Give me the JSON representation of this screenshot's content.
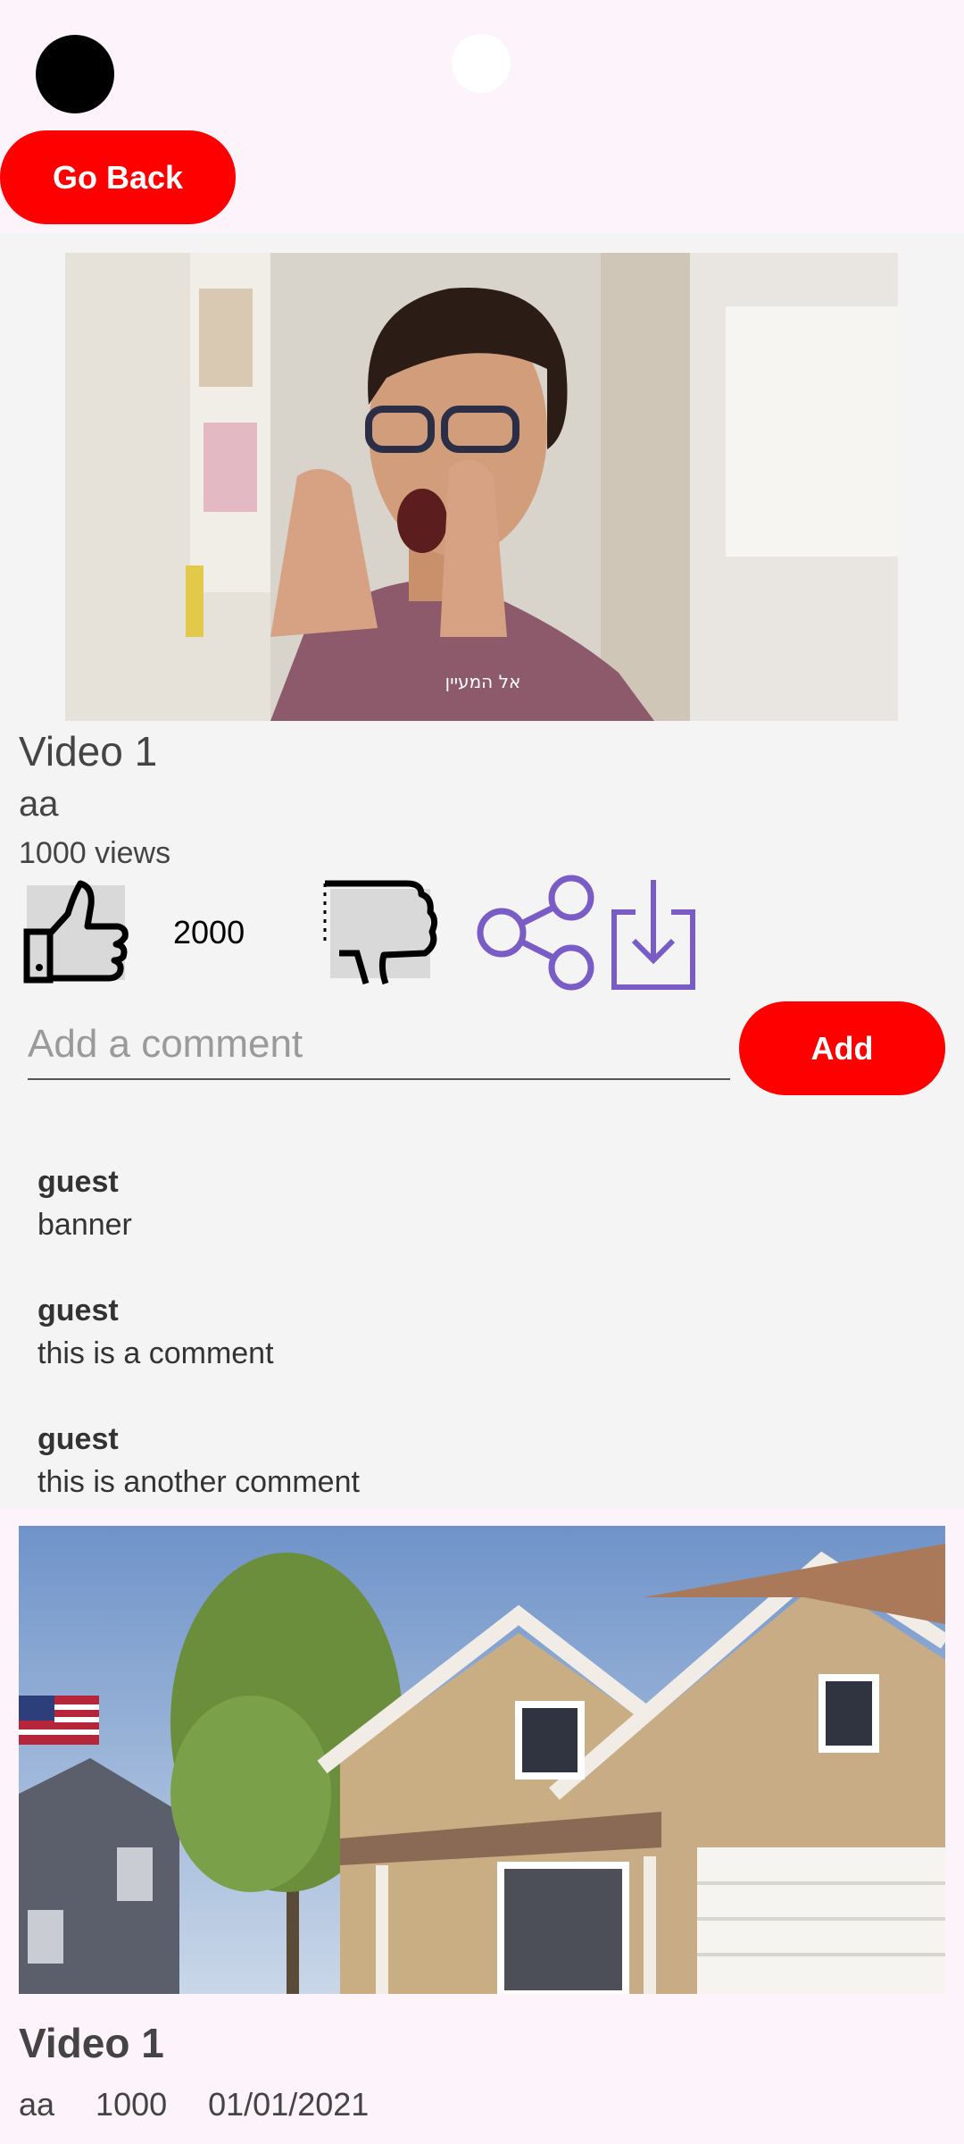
{
  "header": {
    "back_label": "Go Back"
  },
  "player": {
    "caption": "אל המעיין",
    "title": "Video 1",
    "author": "aa",
    "views": "1000 views",
    "likes": "2000"
  },
  "comment_form": {
    "placeholder": "Add a comment",
    "value": "",
    "add_label": "Add"
  },
  "comments": [
    {
      "user": "guest",
      "text": "banner"
    },
    {
      "user": "guest",
      "text": "this is a comment"
    },
    {
      "user": "guest",
      "text": "this is another comment"
    }
  ],
  "next_video": {
    "title": "Video 1",
    "author": "aa",
    "views": "1000",
    "date": "01/01/2021"
  },
  "colors": {
    "accent": "#ff0000",
    "icon_purple": "#7a5cc7",
    "page_bg": "#fcf3fb",
    "panel_bg": "#f4f4f4"
  },
  "icons": {
    "like": "thumbs-up-icon",
    "dislike": "thumbs-down-icon",
    "share": "share-icon",
    "download": "download-icon"
  }
}
